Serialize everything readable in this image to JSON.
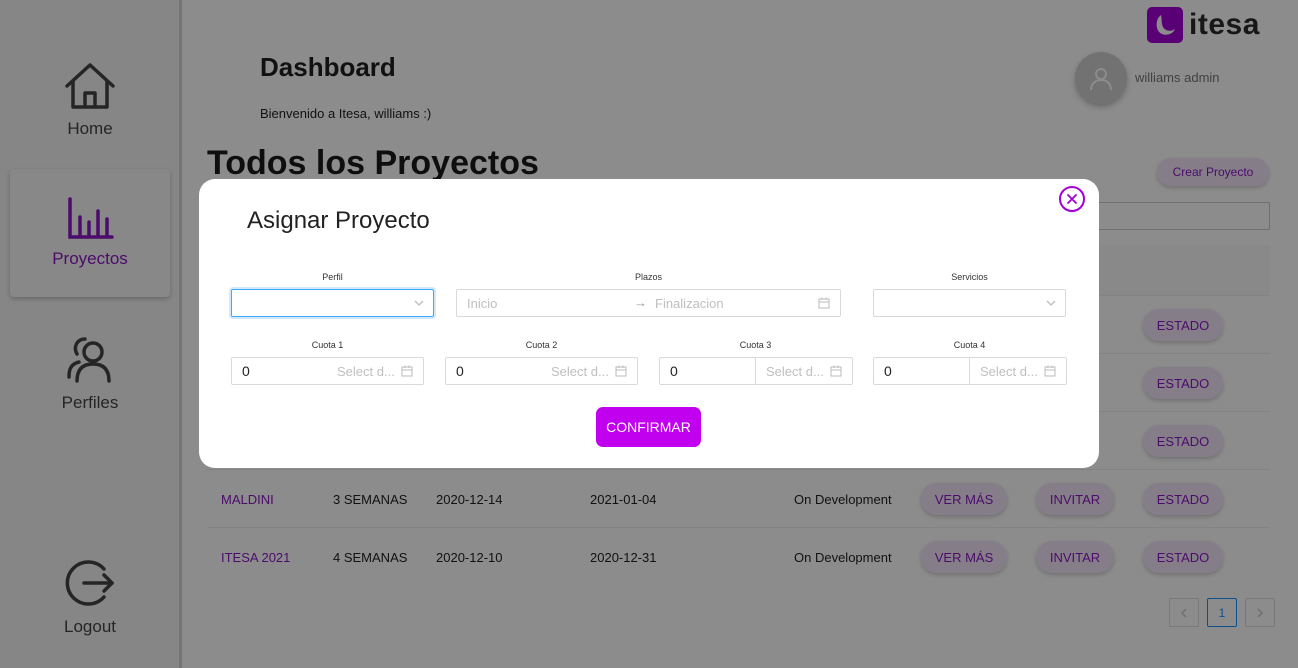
{
  "sidebar": {
    "items": [
      {
        "label": "Home",
        "icon": "home-icon"
      },
      {
        "label": "Proyectos",
        "icon": "chart-bar-icon"
      },
      {
        "label": "Perfiles",
        "icon": "users-icon"
      },
      {
        "label": "Logout",
        "icon": "logout-icon"
      }
    ]
  },
  "header": {
    "logo_text": "itesa",
    "title": "Dashboard",
    "welcome": "Bienvenido a Itesa, williams :)",
    "user_name": "williams admin"
  },
  "main": {
    "section_title": "Todos los Proyectos",
    "create_button": "Crear Proyecto",
    "rows": [
      {
        "name": "MALDINI",
        "duration": "3 SEMANAS",
        "start": "2020-12-14",
        "end": "2021-01-04",
        "status": "On Development",
        "ver": "VER MÁS",
        "invitar": "INVITAR",
        "estado": "ESTADO"
      },
      {
        "name": "ITESA 2021",
        "duration": "4 SEMANAS",
        "start": "2020-12-10",
        "end": "2020-12-31",
        "status": "On Development",
        "ver": "VER MÁS",
        "invitar": "INVITAR",
        "estado": "ESTADO"
      }
    ],
    "hidden_estado": [
      "ESTADO",
      "ESTADO",
      "ESTADO"
    ],
    "pagination": {
      "current": "1"
    }
  },
  "modal": {
    "title": "Asignar Proyecto",
    "labels": {
      "perfil": "Perfil",
      "plazos": "Plazos",
      "servicios": "Servicios"
    },
    "plazos": {
      "start_placeholder": "Inicio",
      "arrow": "→",
      "end_placeholder": "Finalizacion"
    },
    "cuotas": [
      {
        "label": "Cuota 1",
        "value": "0",
        "date_placeholder": "Select d..."
      },
      {
        "label": "Cuota 2",
        "value": "0",
        "date_placeholder": "Select d..."
      },
      {
        "label": "Cuota 3",
        "value": "0",
        "date_placeholder": "Select d..."
      },
      {
        "label": "Cuota 4",
        "value": "0",
        "date_placeholder": "Select d..."
      }
    ],
    "confirm": "CONFIRMAR"
  },
  "colors": {
    "accent": "#a300d8",
    "accent_text": "#8a17c4",
    "confirm": "#c200f0",
    "focus": "#40a9ff"
  }
}
